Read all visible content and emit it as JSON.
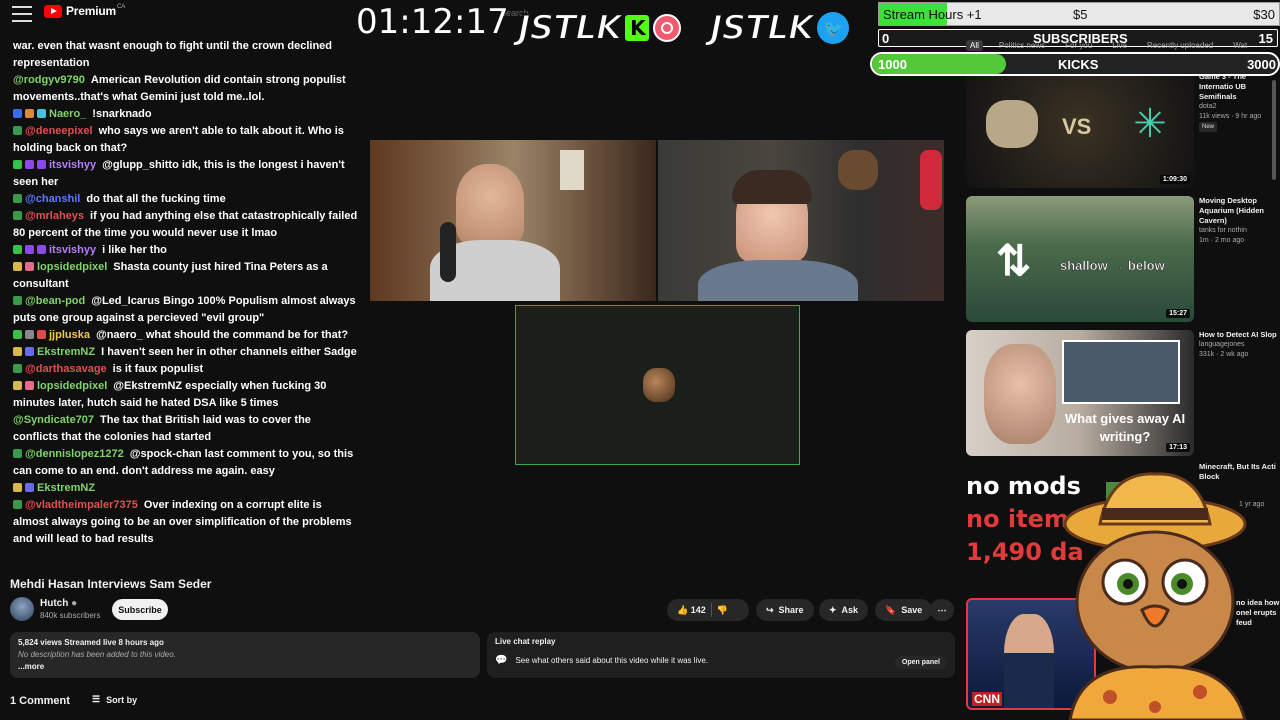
{
  "header": {
    "logo_label": "Premium",
    "logo_region": "CA",
    "search_placeholder": "Search"
  },
  "overlay": {
    "timer": "01:12:17",
    "brand_text": "JSTLK",
    "stream_hours": {
      "label": "Stream Hours +1",
      "tiers": [
        "$5",
        "$30"
      ],
      "fill": 0.17
    },
    "subscribers": {
      "label": "SUBSCRIBERS",
      "current": "0",
      "goal": "15"
    },
    "kicks": {
      "label": "KICKS",
      "current": "1000",
      "goal": "3000",
      "fill": 0.33
    },
    "colors": {
      "kick_green": "#53fc18",
      "twitter_blue": "#1da1f2"
    }
  },
  "filter_chips": [
    "All",
    "Politics news",
    "For you",
    "Live",
    "Recently uploaded",
    "Wat"
  ],
  "chat": [
    {
      "author": "",
      "color": "#ffffff",
      "text": "war. even that wasnt enough to fight until the crown declined representation",
      "badges": []
    },
    {
      "author": "@rodgyv9790",
      "color": "#7fd46a",
      "text": "American Revolution did contain strong populist movements..that's what Gemini just told me..lol.",
      "badges": []
    },
    {
      "author": "Naero_",
      "color": "#7fd46a",
      "text": "!snarknado",
      "badges": [
        "#3a6ee8",
        "#d88a3a",
        "#4ac0e0"
      ]
    },
    {
      "author": "@deneepixel",
      "color": "#e05050",
      "text": "who says we aren't able to talk about it. Who is holding back on that?",
      "badges": [
        "#3a9a4a"
      ]
    },
    {
      "author": "itsvishyy",
      "color": "#b57fff",
      "text": "@glupp_shitto idk, this is the longest i haven't seen her",
      "badges": [
        "#3ac04a",
        "#8a4ae8",
        "#8a4ae8"
      ]
    },
    {
      "author": "@chanshil",
      "color": "#5a7aff",
      "text": "do that all the fucking time",
      "badges": [
        "#3a9a4a"
      ]
    },
    {
      "author": "@mrlaheys",
      "color": "#e05050",
      "text": "if you had anything else that catastrophically failed 80 percent of the time you would never use it lmao",
      "badges": [
        "#3a9a4a"
      ]
    },
    {
      "author": "itsvishyy",
      "color": "#b57fff",
      "text": "i like her tho",
      "badges": [
        "#3ac04a",
        "#8a4ae8",
        "#8a4ae8"
      ]
    },
    {
      "author": "lopsidedpixel",
      "color": "#7fd46a",
      "text": "Shasta county just hired Tina Peters as a consultant",
      "badges": [
        "#d8b84a",
        "#e86a8a"
      ]
    },
    {
      "author": "@bean-pod",
      "color": "#7fd46a",
      "text": "@Led_Icarus Bingo 100% Populism almost always puts one group against a percieved \"evil group\"",
      "badges": [
        "#3a9a4a"
      ]
    },
    {
      "author": "jjpluska",
      "color": "#f0c84a",
      "text": "@naero_ what should the command be for that?",
      "badges": [
        "#3ac04a",
        "#888888",
        "#e04a4a"
      ]
    },
    {
      "author": "EkstremNZ",
      "color": "#7fd46a",
      "text": "I haven't seen her in other channels either Sadge",
      "badges": [
        "#d8b84a",
        "#6a6ae8"
      ]
    },
    {
      "author": "@darthasavage",
      "color": "#e05050",
      "text": "is it faux populist",
      "badges": [
        "#3a9a4a"
      ]
    },
    {
      "author": "lopsidedpixel",
      "color": "#7fd46a",
      "text": "@EkstremNZ especially when fucking 30 minutes later, hutch said he hated DSA like 5 times",
      "badges": [
        "#d8b84a",
        "#e86a8a"
      ]
    },
    {
      "author": "@Syndicate707",
      "color": "#7fd46a",
      "text": "The tax that British laid was to cover the conflicts that the colonies had started",
      "badges": []
    },
    {
      "author": "@dennislopez1272",
      "color": "#7fd46a",
      "text": "@spock-chan last comment to you, so this can come to an end. don't address me again. easy",
      "badges": [
        "#3a9a4a"
      ]
    },
    {
      "author": "EkstremNZ",
      "color": "#7fd46a",
      "text": "",
      "badges": [
        "#d8b84a",
        "#6a6ae8"
      ]
    },
    {
      "author": "@vladtheimpaler7375",
      "color": "#e05050",
      "text": "Over indexing on a corrupt elite is almost always going to be an over simplification of the problems and will lead to bad results",
      "badges": [
        "#3a9a4a"
      ]
    }
  ],
  "video": {
    "title": "Mehdi Hasan Interviews Sam Seder",
    "channel": "Hutch",
    "subscribers": "840k subscribers",
    "subscribe_label": "Subscribe",
    "likes": "142",
    "share_label": "Share",
    "ask_label": "Ask",
    "save_label": "Save",
    "views_line": "5,824 views  Streamed live 8 hours ago",
    "description": "No description has been added to this video.",
    "more_label": "...more",
    "replay_title": "Live chat replay",
    "replay_text": "See what others said about this video while it was live.",
    "open_panel_label": "Open panel",
    "comments_count": "1 Comment",
    "sort_label": "Sort by"
  },
  "suggestions": [
    {
      "title": "[EN] Team Spirit vs Game 3 - The Internatio UB Semifinals",
      "channel": "dota2",
      "meta": "11k views · 9 hr ago",
      "badge": "New",
      "duration": "1:09:30",
      "thumb_text": "VS"
    },
    {
      "title": "Moving Desktop Aquarium (Hidden Cavern)",
      "channel": "tanks for nothin",
      "meta": "1m · 2 mo ago",
      "badge": "",
      "duration": "15:27",
      "thumb_text": "shallow → below"
    },
    {
      "title": "How to Detect AI Slop",
      "channel": "languagejones",
      "meta": "331k · 2 wk ago",
      "badge": "",
      "duration": "17:13",
      "thumb_text": "What gives away AI writing?"
    },
    {
      "title": "Minecraft, But Its Acti Block",
      "channel": "",
      "meta": "1 yr ago",
      "badge": "",
      "duration": "",
      "thumb_text": ""
    },
    {
      "title": "no idea how onel erupts feud",
      "channel": "",
      "meta": "",
      "badge": "",
      "duration": "",
      "thumb_text": "CNN"
    }
  ],
  "promo": {
    "line1": "no mods",
    "line2": "no items",
    "line3": "1,490 da"
  }
}
